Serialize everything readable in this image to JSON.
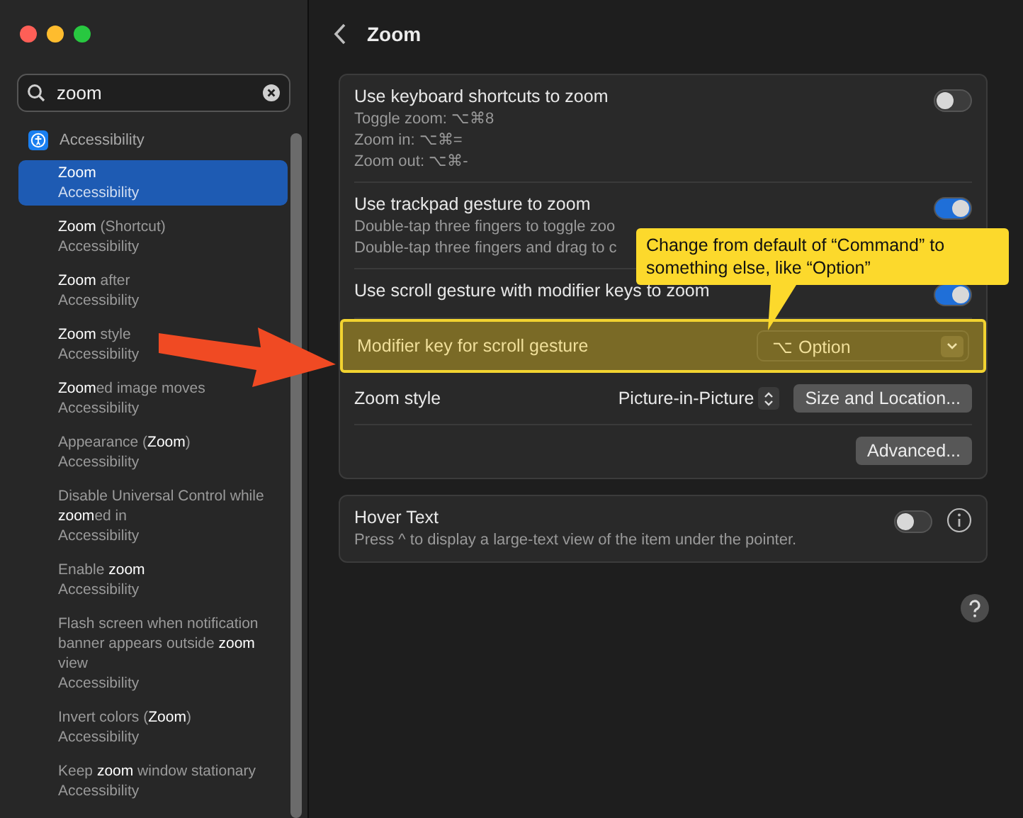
{
  "sidebar": {
    "search": {
      "value": "zoom"
    },
    "section": {
      "label": "Accessibility"
    },
    "results": [
      {
        "title": "**Zoom**",
        "subtitle": "Accessibility",
        "selected": true
      },
      {
        "title": "**Zoom** (Shortcut)",
        "subtitle": "Accessibility",
        "selected": false
      },
      {
        "title": "**Zoom** after",
        "subtitle": "Accessibility",
        "selected": false
      },
      {
        "title": "**Zoom** style",
        "subtitle": "Accessibility",
        "selected": false
      },
      {
        "title": "**Zoom**ed image moves",
        "subtitle": "Accessibility",
        "selected": false
      },
      {
        "title": "Appearance (**Zoom**)",
        "subtitle": "Accessibility",
        "selected": false
      },
      {
        "title": "Disable Universal Control while **zoom**ed in",
        "subtitle": "Accessibility",
        "selected": false
      },
      {
        "title": "Enable **zoom**",
        "subtitle": "Accessibility",
        "selected": false
      },
      {
        "title": "Flash screen when notification banner appears outside **zoom** view",
        "subtitle": "Accessibility",
        "selected": false
      },
      {
        "title": "Invert colors (**Zoom**)",
        "subtitle": "Accessibility",
        "selected": false
      },
      {
        "title": "Keep **zoom** window stationary",
        "subtitle": "Accessibility",
        "selected": false
      }
    ]
  },
  "header": {
    "title": "Zoom"
  },
  "zoom_card": {
    "rows": [
      {
        "kind": "toggle",
        "label": "Use keyboard shortcuts to zoom",
        "details": [
          "Toggle zoom: ⌥⌘8",
          "Zoom in: ⌥⌘=",
          "Zoom out: ⌥⌘-"
        ],
        "on": false
      },
      {
        "kind": "toggle",
        "label": "Use trackpad gesture to zoom",
        "details": [
          "Double-tap three fingers to toggle zoo",
          "Double-tap three fingers and drag to c"
        ],
        "on": true
      },
      {
        "kind": "toggle",
        "label": "Use scroll gesture with modifier keys to zoom",
        "on": true
      },
      {
        "kind": "popup",
        "label": "Modifier key for scroll gesture",
        "value": "⌥ Option",
        "highlighted": true
      },
      {
        "kind": "style",
        "label": "Zoom style",
        "value": "Picture-in-Picture",
        "button": "Size and Location..."
      },
      {
        "kind": "button",
        "button": "Advanced..."
      }
    ]
  },
  "hover_card": {
    "label": "Hover Text",
    "description": "Press ^ to display a large-text view of the item under the pointer.",
    "on": false
  },
  "annotation": {
    "callout": "Change from default of “Command” to something else, like “Option”"
  }
}
